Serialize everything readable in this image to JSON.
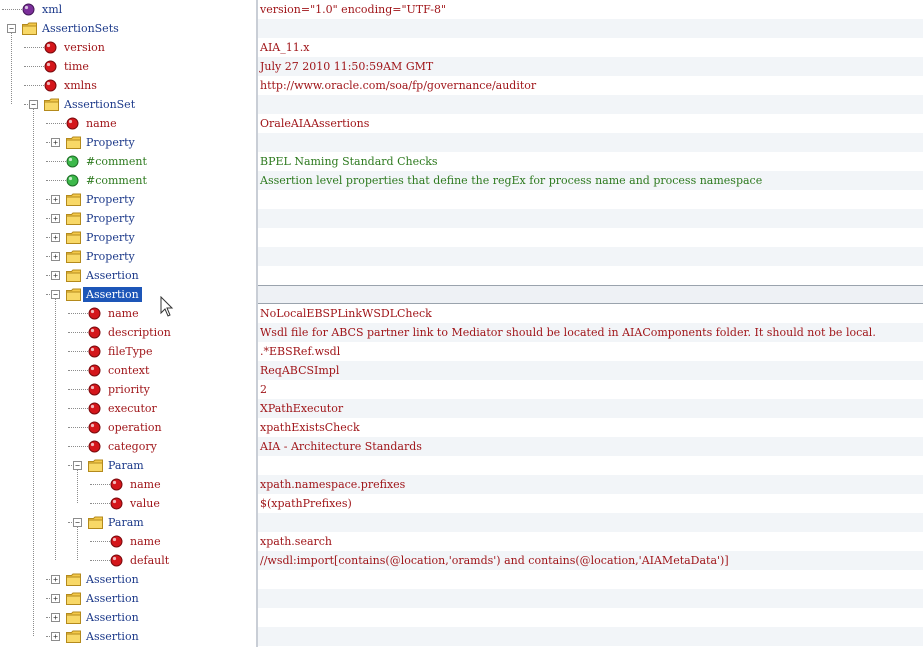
{
  "colors": {
    "element_text": "#1d3a8a",
    "attribute_text": "#a0161a",
    "comment_text": "#2e7a1f",
    "selection": "#1d56b8"
  },
  "tree": [
    {
      "label": "xml",
      "kind": "pi",
      "depth": 0,
      "exp": "none",
      "icon": "purple-dot-icon"
    },
    {
      "label": "AssertionSets",
      "kind": "element",
      "depth": 0,
      "exp": "minus",
      "icon": "folder-icon"
    },
    {
      "label": "version",
      "kind": "attribute",
      "depth": 1,
      "exp": "none",
      "icon": "red-dot-icon"
    },
    {
      "label": "time",
      "kind": "attribute",
      "depth": 1,
      "exp": "none",
      "icon": "red-dot-icon"
    },
    {
      "label": "xmlns",
      "kind": "attribute",
      "depth": 1,
      "exp": "none",
      "icon": "red-dot-icon"
    },
    {
      "label": "AssertionSet",
      "kind": "element",
      "depth": 1,
      "exp": "minus",
      "icon": "folder-icon"
    },
    {
      "label": "name",
      "kind": "attribute",
      "depth": 2,
      "exp": "none",
      "icon": "red-dot-icon"
    },
    {
      "label": "Property",
      "kind": "element",
      "depth": 2,
      "exp": "plus",
      "icon": "folder-icon"
    },
    {
      "label": "#comment",
      "kind": "comment",
      "depth": 2,
      "exp": "none",
      "icon": "green-dot-icon"
    },
    {
      "label": "#comment",
      "kind": "comment",
      "depth": 2,
      "exp": "none",
      "icon": "green-dot-icon"
    },
    {
      "label": "Property",
      "kind": "element",
      "depth": 2,
      "exp": "plus",
      "icon": "folder-icon"
    },
    {
      "label": "Property",
      "kind": "element",
      "depth": 2,
      "exp": "plus",
      "icon": "folder-icon"
    },
    {
      "label": "Property",
      "kind": "element",
      "depth": 2,
      "exp": "plus",
      "icon": "folder-icon"
    },
    {
      "label": "Property",
      "kind": "element",
      "depth": 2,
      "exp": "plus",
      "icon": "folder-icon"
    },
    {
      "label": "Assertion",
      "kind": "element",
      "depth": 2,
      "exp": "plus",
      "icon": "folder-icon"
    },
    {
      "label": "Assertion",
      "kind": "element",
      "depth": 2,
      "exp": "minus",
      "icon": "folder-icon",
      "selected": true
    },
    {
      "label": "name",
      "kind": "attribute",
      "depth": 3,
      "exp": "none",
      "icon": "red-dot-icon"
    },
    {
      "label": "description",
      "kind": "attribute",
      "depth": 3,
      "exp": "none",
      "icon": "red-dot-icon"
    },
    {
      "label": "fileType",
      "kind": "attribute",
      "depth": 3,
      "exp": "none",
      "icon": "red-dot-icon"
    },
    {
      "label": "context",
      "kind": "attribute",
      "depth": 3,
      "exp": "none",
      "icon": "red-dot-icon"
    },
    {
      "label": "priority",
      "kind": "attribute",
      "depth": 3,
      "exp": "none",
      "icon": "red-dot-icon"
    },
    {
      "label": "executor",
      "kind": "attribute",
      "depth": 3,
      "exp": "none",
      "icon": "red-dot-icon"
    },
    {
      "label": "operation",
      "kind": "attribute",
      "depth": 3,
      "exp": "none",
      "icon": "red-dot-icon"
    },
    {
      "label": "category",
      "kind": "attribute",
      "depth": 3,
      "exp": "none",
      "icon": "red-dot-icon"
    },
    {
      "label": "Param",
      "kind": "element",
      "depth": 3,
      "exp": "minus",
      "icon": "folder-icon"
    },
    {
      "label": "name",
      "kind": "attribute",
      "depth": 4,
      "exp": "none",
      "icon": "red-dot-icon"
    },
    {
      "label": "value",
      "kind": "attribute",
      "depth": 4,
      "exp": "none",
      "icon": "red-dot-icon"
    },
    {
      "label": "Param",
      "kind": "element",
      "depth": 3,
      "exp": "minus",
      "icon": "folder-icon"
    },
    {
      "label": "name",
      "kind": "attribute",
      "depth": 4,
      "exp": "none",
      "icon": "red-dot-icon"
    },
    {
      "label": "default",
      "kind": "attribute",
      "depth": 4,
      "exp": "none",
      "icon": "red-dot-icon"
    },
    {
      "label": "Assertion",
      "kind": "element",
      "depth": 2,
      "exp": "plus",
      "icon": "folder-icon"
    },
    {
      "label": "Assertion",
      "kind": "element",
      "depth": 2,
      "exp": "plus",
      "icon": "folder-icon"
    },
    {
      "label": "Assertion",
      "kind": "element",
      "depth": 2,
      "exp": "plus",
      "icon": "folder-icon"
    },
    {
      "label": "Assertion",
      "kind": "element",
      "depth": 2,
      "exp": "plus",
      "icon": "folder-icon"
    }
  ],
  "values": [
    {
      "text": "version=\"1.0\" encoding=\"UTF-8\"",
      "tone": "red"
    },
    {
      "text": "",
      "tone": "red"
    },
    {
      "text": "AIA_11.x",
      "tone": "red"
    },
    {
      "text": "July 27 2010 11:50:59AM GMT",
      "tone": "red"
    },
    {
      "text": "http://www.oracle.com/soa/fp/governance/auditor",
      "tone": "red"
    },
    {
      "text": "",
      "tone": "red"
    },
    {
      "text": "OraleAIAAssertions",
      "tone": "red"
    },
    {
      "text": "",
      "tone": "red"
    },
    {
      "text": "BPEL Naming Standard Checks",
      "tone": "green"
    },
    {
      "text": "Assertion level properties that define the regEx for process name and process namespace",
      "tone": "green"
    },
    {
      "text": "",
      "tone": "red"
    },
    {
      "text": "",
      "tone": "red"
    },
    {
      "text": "",
      "tone": "red"
    },
    {
      "text": "",
      "tone": "red"
    },
    {
      "text": "",
      "tone": "red"
    },
    {
      "text": "",
      "tone": "red",
      "sel": true
    },
    {
      "text": "NoLocalEBSPLinkWSDLCheck",
      "tone": "red"
    },
    {
      "text": "Wsdl file for ABCS partner link to Mediator should be located in AIAComponents folder. It should not be local.",
      "tone": "red"
    },
    {
      "text": ".*EBSRef.wsdl",
      "tone": "red"
    },
    {
      "text": "ReqABCSImpl",
      "tone": "red"
    },
    {
      "text": "2",
      "tone": "red"
    },
    {
      "text": "XPathExecutor",
      "tone": "red"
    },
    {
      "text": "xpathExistsCheck",
      "tone": "red"
    },
    {
      "text": "AIA - Architecture Standards",
      "tone": "red"
    },
    {
      "text": "",
      "tone": "red"
    },
    {
      "text": "xpath.namespace.prefixes",
      "tone": "red"
    },
    {
      "text": "$(xpathPrefixes)",
      "tone": "red"
    },
    {
      "text": "",
      "tone": "red"
    },
    {
      "text": "xpath.search",
      "tone": "red"
    },
    {
      "text": "//wsdl:import[contains(@location,'oramds') and contains(@location,'AIAMetaData')]",
      "tone": "red"
    },
    {
      "text": "",
      "tone": "red"
    },
    {
      "text": "",
      "tone": "red"
    },
    {
      "text": "",
      "tone": "red"
    },
    {
      "text": "",
      "tone": "red"
    }
  ]
}
